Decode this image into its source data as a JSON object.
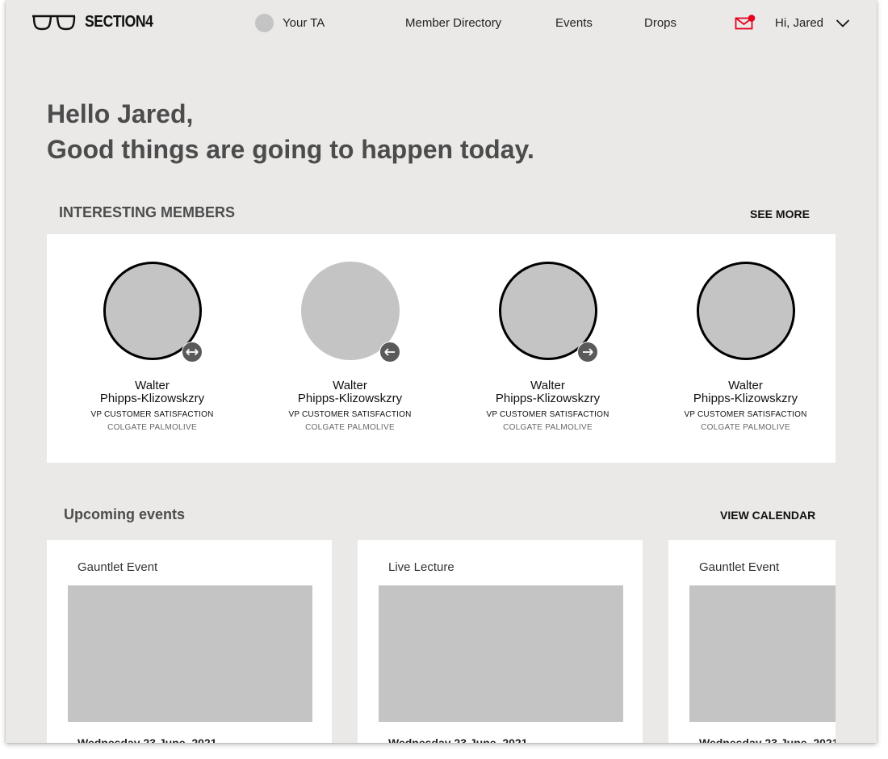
{
  "nav": {
    "logo_text": "SECTION4",
    "ta_label": "Your TA",
    "links": [
      "Member Directory",
      "Events",
      "Drops"
    ],
    "greeting": "Hi, Jared",
    "mail_color": "#e5001d"
  },
  "hero": {
    "line1": "Hello Jared,",
    "line2": "Good things are going to happen today."
  },
  "members": {
    "title": "INTERESTING MEMBERS",
    "see_more": "SEE MORE",
    "items": [
      {
        "name_line1": "Walter",
        "name_line2": "Phipps-Klizowskzry",
        "role": "VP CUSTOMER SATISFACTION",
        "company": "COLGATE PALMOLIVE",
        "connection": "both"
      },
      {
        "name_line1": "Walter",
        "name_line2": "Phipps-Klizowskzry",
        "role": "VP CUSTOMER SATISFACTION",
        "company": "COLGATE PALMOLIVE",
        "connection": "incoming"
      },
      {
        "name_line1": "Walter",
        "name_line2": "Phipps-Klizowskzry",
        "role": "VP CUSTOMER SATISFACTION",
        "company": "COLGATE PALMOLIVE",
        "connection": "outgoing"
      },
      {
        "name_line1": "Walter",
        "name_line2": "Phipps-Klizowskzry",
        "role": "VP CUSTOMER SATISFACTION",
        "company": "COLGATE PALMOLIVE",
        "connection": "none"
      }
    ]
  },
  "events": {
    "title": "Upcoming events",
    "view_calendar": "VIEW CALENDAR",
    "items": [
      {
        "type": "Gauntlet Event",
        "date": "Wednesday 23 June, 2021"
      },
      {
        "type": "Live Lecture",
        "date": "Wednesday 23 June, 2021"
      },
      {
        "type": "Gauntlet Event",
        "date": "Wednesday 23 June, 2021"
      }
    ]
  }
}
